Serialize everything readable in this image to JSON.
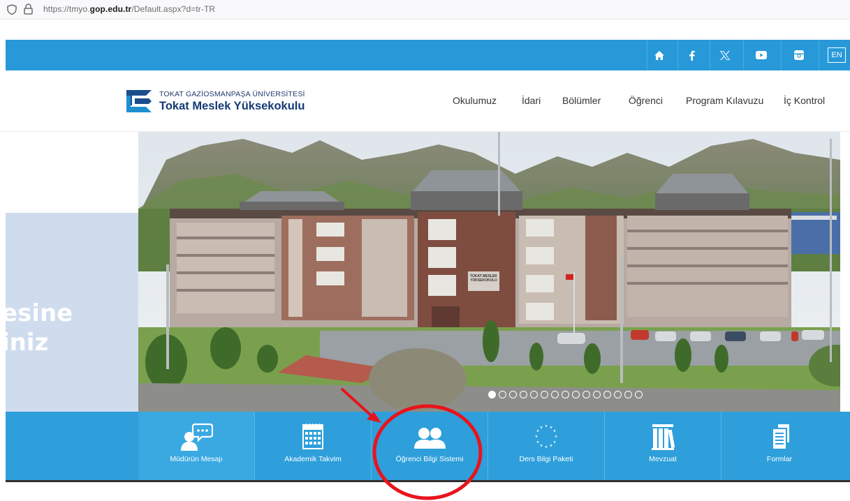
{
  "browser": {
    "url_prefix": "https://tmyo.",
    "url_domain": "gop.edu.tr",
    "url_path": "/Default.aspx?d=tr-TR"
  },
  "topbar": {
    "icons": [
      "home-icon",
      "facebook-icon",
      "x-icon",
      "youtube-icon",
      "instagram-icon"
    ],
    "language_label": "EN",
    "color": "#2799d8"
  },
  "header": {
    "university_name": "TOKAT GAZİOSMANPAŞA ÜNİVERSİTESİ",
    "school_name": "Tokat Meslek Yüksekokulu",
    "nav": [
      "Okulumuz",
      "İdari",
      "Bölümler",
      "Öğrenci",
      "Program Kılavuzu",
      "İç Kontrol"
    ]
  },
  "slider": {
    "slogan_line1": "esine",
    "slogan_line2": "iniz",
    "building_sign": "TOKAT MESLEK YÜKSEKOKULU",
    "slide_count": 15,
    "active_slide": 1
  },
  "quicklinks": {
    "items": [
      {
        "label": "Müdürün Mesajı",
        "icon": "speech-bubble-person-icon"
      },
      {
        "label": "Akademik Takvim",
        "icon": "calendar-icon"
      },
      {
        "label": "Öğrenci Bilgi Sistemi",
        "icon": "users-icon"
      },
      {
        "label": "Ders Bilgi Paketi",
        "icon": "eu-stars-icon"
      },
      {
        "label": "Mevzuat",
        "icon": "books-icon"
      },
      {
        "label": "Formlar",
        "icon": "documents-icon"
      }
    ],
    "color": "#2e9fdb"
  },
  "annotation": {
    "color": "#e8141c",
    "highlighted_item": "Öğrenci Bilgi Sistemi"
  }
}
